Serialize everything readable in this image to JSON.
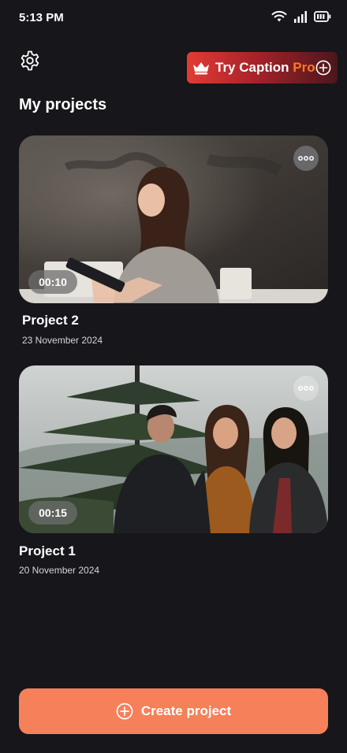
{
  "status_bar": {
    "time": "5:13 PM",
    "icons": [
      "wifi-icon",
      "signal-icon",
      "battery-icon"
    ]
  },
  "header": {
    "settings_icon": "gear-icon",
    "pro_button": {
      "label_main": "Try Caption ",
      "label_accent": "Pro",
      "icon": "crown-icon"
    }
  },
  "page": {
    "title": "My projects"
  },
  "projects": [
    {
      "name": "Project 2",
      "date": "23 November 2024",
      "duration": "00:10"
    },
    {
      "name": "Project 1",
      "date": "20 November 2024",
      "duration": "00:15"
    }
  ],
  "footer": {
    "create_label": "Create project"
  },
  "colors": {
    "background": "#16161b",
    "accent": "#f5805a",
    "pro_red": "#e23b34",
    "pro_orange": "#ff7a1a"
  }
}
